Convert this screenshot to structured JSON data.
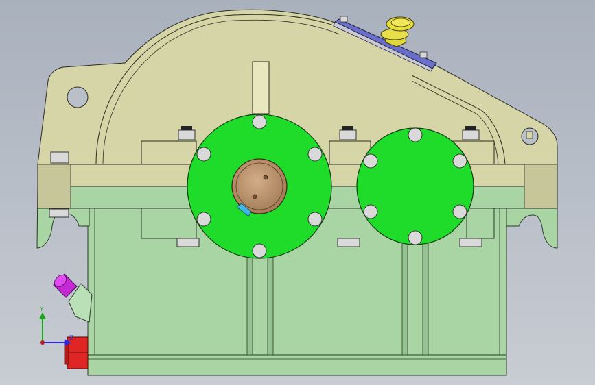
{
  "viewport": {
    "background_top": "#a9b1bd",
    "background_bottom": "#c8ccd3"
  },
  "colors": {
    "cover": "#d6d5a7",
    "cover_edge": "#2b2b20",
    "housing": "#a9d4a3",
    "housing_dark": "#95c291",
    "flange": "#1fdc2a",
    "bolt": "#d9d9d9",
    "bearing_cap": "#c09a74",
    "breather": "#e0d83a",
    "inspection_plate": "#6a70c9",
    "plug": "#c42ad4",
    "drain": "#e02525",
    "key_tab": "#e8e7bd",
    "seal": "#3fb6e0"
  },
  "icons": {
    "triad": "coordinate-triad-icon"
  },
  "triad": {
    "y_label": "Y",
    "z_label": "Z",
    "y_color": "#1aa51a",
    "x_color": "#2a2ae0",
    "z_color": "#c41a1a"
  }
}
